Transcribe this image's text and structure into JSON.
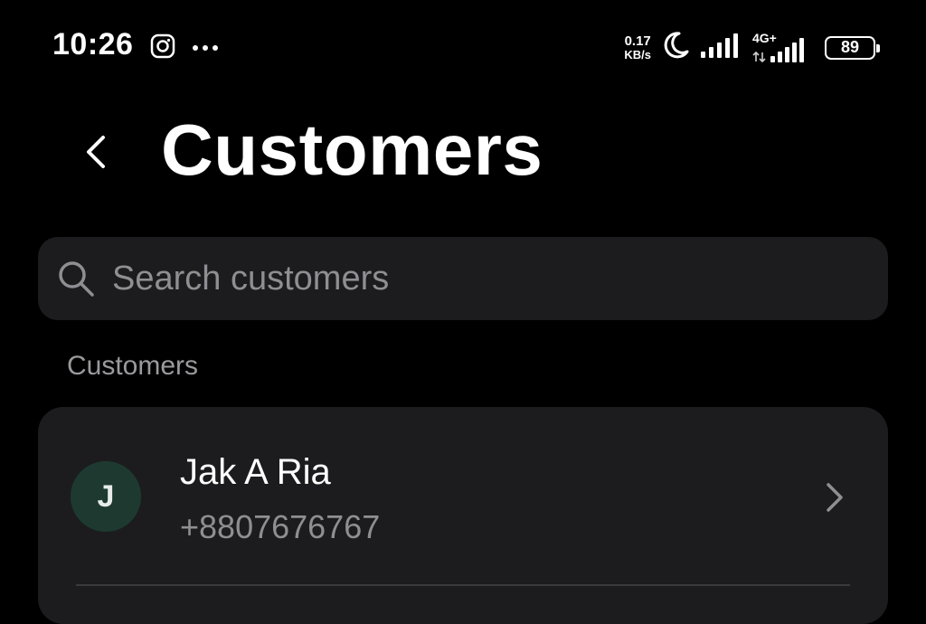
{
  "status_bar": {
    "time": "10:26",
    "net_speed_value": "0.17",
    "net_speed_unit": "KB/s",
    "network_label": "4G+",
    "battery_level": "89",
    "icons": [
      "instagram-icon",
      "more-dots-icon",
      "moon-icon",
      "signal-icon",
      "signal-4g-icon",
      "battery-icon"
    ]
  },
  "header": {
    "title": "Customers",
    "back_icon": "chevron-left-icon"
  },
  "search": {
    "placeholder": "Search customers",
    "value": "",
    "icon": "search-icon"
  },
  "section": {
    "label": "Customers"
  },
  "customers": [
    {
      "initial": "J",
      "name": "Jak A Ria",
      "phone": "+8807676767"
    }
  ],
  "colors": {
    "background": "#000000",
    "surface": "#1c1c1e",
    "avatar_bg": "#1e3a30",
    "secondary_text": "#8e8e93",
    "divider": "#3a3a3c"
  }
}
